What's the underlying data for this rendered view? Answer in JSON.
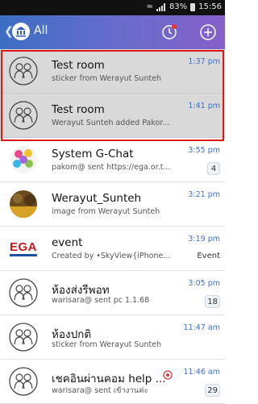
{
  "status_bar": {
    "battery": "83%",
    "time": "15:56"
  },
  "header": {
    "title": "All"
  },
  "chats": [
    {
      "name": "Test room",
      "preview": "sticker from Werayut Sunteh",
      "time": "1:37 pm",
      "badge": ""
    },
    {
      "name": "Test room",
      "preview": "Werayut Sunteh added Pakor...",
      "time": "1:41 pm",
      "badge": ""
    },
    {
      "name": "System G-Chat",
      "preview": "pakom@ sent https://ega.or.t...",
      "time": "3:55 pm",
      "badge": "4"
    },
    {
      "name": "Werayut_Sunteh",
      "preview": "image from Werayut Sunteh",
      "time": "3:21 pm",
      "badge": ""
    },
    {
      "name": "event",
      "preview": "Created by •SkyView{iPhone...",
      "time": "3:19 pm",
      "tag": "Event",
      "logo_text": "EGA"
    },
    {
      "name": "ห้องส่งรีพอท",
      "preview": "warisara@ sent pc 1.1.68",
      "time": "3:05 pm",
      "badge": "18"
    },
    {
      "name": "ห้องปกติ",
      "preview": "sticker from Werayut Sunteh",
      "time": "11:47 am",
      "badge": ""
    },
    {
      "name": "เชคอินผ่านคอม help ...",
      "preview": "warisara@ sent เข้างานค่ะ",
      "time": "11:46 am",
      "badge": "29"
    }
  ],
  "colors": {
    "accent": "#3f6fc8",
    "highlight": "#e01515",
    "header_start": "#3c6fc4",
    "header_end": "#8560c9"
  }
}
